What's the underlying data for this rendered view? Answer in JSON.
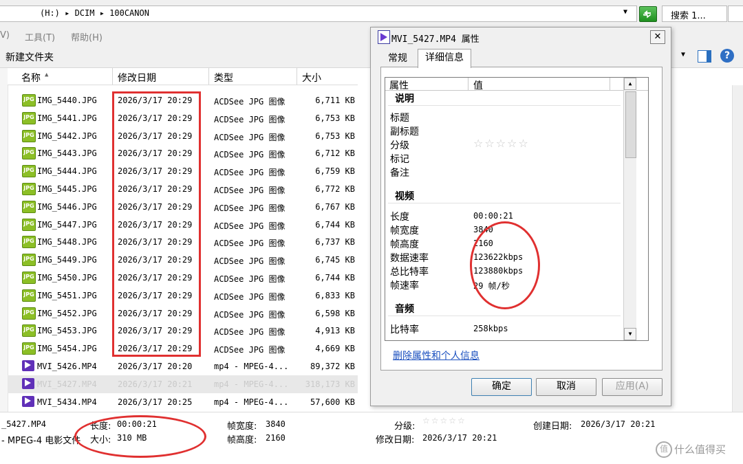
{
  "address": {
    "path": "(H:) ▸ DCIM ▸ 100CANON",
    "search": "搜索 1..."
  },
  "menu": [
    {
      "label": "V)"
    },
    {
      "label": "工具(T)"
    },
    {
      "label": "帮助(H)"
    }
  ],
  "toolbar": {
    "new_folder": "新建文件夹"
  },
  "columns": {
    "name": "名称",
    "date": "修改日期",
    "type": "类型",
    "size": "大小"
  },
  "files": [
    {
      "name": "IMG_5440.JPG",
      "date": "2026/3/17 20:29",
      "type": "ACDSee JPG 图像",
      "size": "6,711 KB",
      "kind": "jpg"
    },
    {
      "name": "IMG_5441.JPG",
      "date": "2026/3/17 20:29",
      "type": "ACDSee JPG 图像",
      "size": "6,753 KB",
      "kind": "jpg"
    },
    {
      "name": "IMG_5442.JPG",
      "date": "2026/3/17 20:29",
      "type": "ACDSee JPG 图像",
      "size": "6,753 KB",
      "kind": "jpg"
    },
    {
      "name": "IMG_5443.JPG",
      "date": "2026/3/17 20:29",
      "type": "ACDSee JPG 图像",
      "size": "6,712 KB",
      "kind": "jpg"
    },
    {
      "name": "IMG_5444.JPG",
      "date": "2026/3/17 20:29",
      "type": "ACDSee JPG 图像",
      "size": "6,759 KB",
      "kind": "jpg"
    },
    {
      "name": "IMG_5445.JPG",
      "date": "2026/3/17 20:29",
      "type": "ACDSee JPG 图像",
      "size": "6,772 KB",
      "kind": "jpg"
    },
    {
      "name": "IMG_5446.JPG",
      "date": "2026/3/17 20:29",
      "type": "ACDSee JPG 图像",
      "size": "6,767 KB",
      "kind": "jpg"
    },
    {
      "name": "IMG_5447.JPG",
      "date": "2026/3/17 20:29",
      "type": "ACDSee JPG 图像",
      "size": "6,744 KB",
      "kind": "jpg"
    },
    {
      "name": "IMG_5448.JPG",
      "date": "2026/3/17 20:29",
      "type": "ACDSee JPG 图像",
      "size": "6,737 KB",
      "kind": "jpg"
    },
    {
      "name": "IMG_5449.JPG",
      "date": "2026/3/17 20:29",
      "type": "ACDSee JPG 图像",
      "size": "6,745 KB",
      "kind": "jpg"
    },
    {
      "name": "IMG_5450.JPG",
      "date": "2026/3/17 20:29",
      "type": "ACDSee JPG 图像",
      "size": "6,744 KB",
      "kind": "jpg"
    },
    {
      "name": "IMG_5451.JPG",
      "date": "2026/3/17 20:29",
      "type": "ACDSee JPG 图像",
      "size": "6,833 KB",
      "kind": "jpg"
    },
    {
      "name": "IMG_5452.JPG",
      "date": "2026/3/17 20:29",
      "type": "ACDSee JPG 图像",
      "size": "6,598 KB",
      "kind": "jpg"
    },
    {
      "name": "IMG_5453.JPG",
      "date": "2026/3/17 20:29",
      "type": "ACDSee JPG 图像",
      "size": "4,913 KB",
      "kind": "jpg"
    },
    {
      "name": "IMG_5454.JPG",
      "date": "2026/3/17 20:29",
      "type": "ACDSee JPG 图像",
      "size": "4,669 KB",
      "kind": "jpg"
    },
    {
      "name": "MVI_5426.MP4",
      "date": "2026/3/17 20:20",
      "type": "mp4 - MPEG-4...",
      "size": "89,372 KB",
      "kind": "mp4"
    },
    {
      "name": "MVI_5427.MP4",
      "date": "2026/3/17 20:21",
      "type": "mp4 - MPEG-4...",
      "size": "318,173 KB",
      "kind": "mp4",
      "selected": true
    },
    {
      "name": "MVI_5434.MP4",
      "date": "2026/3/17 20:25",
      "type": "mp4 - MPEG-4...",
      "size": "57,600 KB",
      "kind": "mp4"
    }
  ],
  "icon_labels": {
    "jpg": "JPG",
    "mp4": "MP4"
  },
  "dialog": {
    "title": "MVI_5427.MP4 属性",
    "close": "✕",
    "tabs": [
      "常规",
      "详细信息"
    ],
    "list_header": {
      "prop": "属性",
      "value": "值"
    },
    "sections": {
      "desc": {
        "title": "说明",
        "items": [
          {
            "label": "标题",
            "value": ""
          },
          {
            "label": "副标题",
            "value": ""
          },
          {
            "label": "分级",
            "value": "☆☆☆☆☆"
          },
          {
            "label": "标记",
            "value": ""
          },
          {
            "label": "备注",
            "value": ""
          }
        ]
      },
      "video": {
        "title": "视频",
        "items": [
          {
            "label": "长度",
            "value": "00:00:21"
          },
          {
            "label": "帧宽度",
            "value": "3840"
          },
          {
            "label": "帧高度",
            "value": "2160"
          },
          {
            "label": "数据速率",
            "value": "123622kbps"
          },
          {
            "label": "总比特率",
            "value": "123880kbps"
          },
          {
            "label": "帧速率",
            "value": "29 帧/秒"
          }
        ]
      },
      "audio": {
        "title": "音频",
        "items": [
          {
            "label": "比特率",
            "value": "258kbps"
          }
        ]
      }
    },
    "remove_link": "删除属性和个人信息",
    "buttons": {
      "ok": "确定",
      "cancel": "取消",
      "apply": "应用(A)"
    }
  },
  "details": {
    "filename": "_5427.MP4",
    "filetype": "- MPEG-4 电影文件",
    "length_label": "长度:",
    "length": "00:00:21",
    "size_label": "大小:",
    "size": "310 MB",
    "width_label": "帧宽度:",
    "width": "3840",
    "height_label": "帧高度:",
    "height": "2160",
    "rating_label": "分级:",
    "rating": "☆☆☆☆☆",
    "modified_label": "修改日期:",
    "modified": "2026/3/17 20:21",
    "created_label": "创建日期:",
    "created": "2026/3/17 20:21"
  },
  "watermark": {
    "logo": "值",
    "text": "什么值得买"
  },
  "colors": {
    "accent": "#e03030",
    "link": "#1a4fbf",
    "mp4_icon": "#6030b8",
    "jpg_icon": "#8cbf26"
  }
}
